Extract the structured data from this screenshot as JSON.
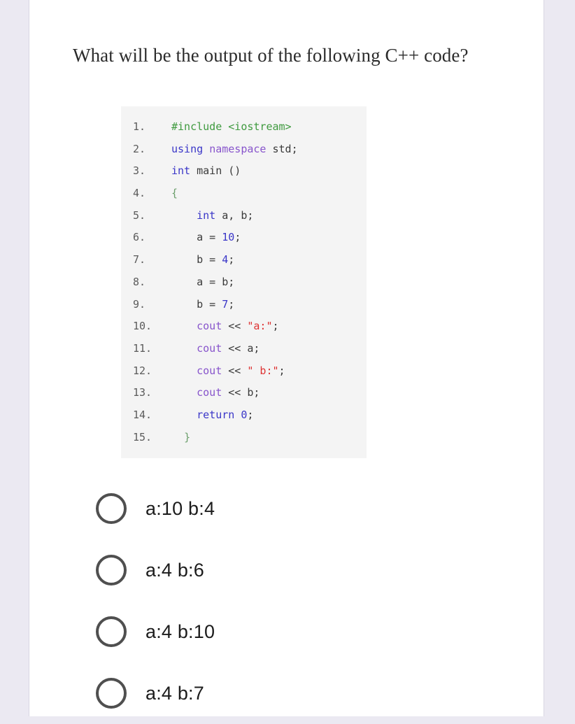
{
  "question": {
    "text": "What will be the output of the following C++ code?"
  },
  "code": {
    "language": "C++",
    "lines": [
      {
        "number": "1.",
        "tokens": [
          {
            "t": "#include ",
            "c": "pre"
          },
          {
            "t": "<iostream>",
            "c": "inc"
          }
        ]
      },
      {
        "number": "2.",
        "tokens": [
          {
            "t": "using ",
            "c": "kw"
          },
          {
            "t": "namespace ",
            "c": "ns"
          },
          {
            "t": "std;",
            "c": "plain"
          }
        ]
      },
      {
        "number": "3.",
        "tokens": [
          {
            "t": "int ",
            "c": "kw"
          },
          {
            "t": "main ()",
            "c": "plain"
          }
        ]
      },
      {
        "number": "4.",
        "tokens": [
          {
            "t": "{",
            "c": "brace"
          }
        ]
      },
      {
        "number": "5.",
        "tokens": [
          {
            "t": "    ",
            "c": "plain"
          },
          {
            "t": "int ",
            "c": "kw"
          },
          {
            "t": "a, b;",
            "c": "plain"
          }
        ]
      },
      {
        "number": "6.",
        "tokens": [
          {
            "t": "    a = ",
            "c": "plain"
          },
          {
            "t": "10",
            "c": "num"
          },
          {
            "t": ";",
            "c": "plain"
          }
        ]
      },
      {
        "number": "7.",
        "tokens": [
          {
            "t": "    b = ",
            "c": "plain"
          },
          {
            "t": "4",
            "c": "num"
          },
          {
            "t": ";",
            "c": "plain"
          }
        ]
      },
      {
        "number": "8.",
        "tokens": [
          {
            "t": "    a = b;",
            "c": "plain"
          }
        ]
      },
      {
        "number": "9.",
        "tokens": [
          {
            "t": "    b = ",
            "c": "plain"
          },
          {
            "t": "7",
            "c": "num"
          },
          {
            "t": ";",
            "c": "plain"
          }
        ]
      },
      {
        "number": "10.",
        "tokens": [
          {
            "t": "    ",
            "c": "plain"
          },
          {
            "t": "cout",
            "c": "ns"
          },
          {
            "t": " << ",
            "c": "plain"
          },
          {
            "t": "\"a:\"",
            "c": "str"
          },
          {
            "t": ";",
            "c": "plain"
          }
        ]
      },
      {
        "number": "11.",
        "tokens": [
          {
            "t": "    ",
            "c": "plain"
          },
          {
            "t": "cout",
            "c": "ns"
          },
          {
            "t": " << a;",
            "c": "plain"
          }
        ]
      },
      {
        "number": "12.",
        "tokens": [
          {
            "t": "    ",
            "c": "plain"
          },
          {
            "t": "cout",
            "c": "ns"
          },
          {
            "t": " << ",
            "c": "plain"
          },
          {
            "t": "\" b:\"",
            "c": "str"
          },
          {
            "t": ";",
            "c": "plain"
          }
        ]
      },
      {
        "number": "13.",
        "tokens": [
          {
            "t": "    ",
            "c": "plain"
          },
          {
            "t": "cout",
            "c": "ns"
          },
          {
            "t": " << b;",
            "c": "plain"
          }
        ]
      },
      {
        "number": "14.",
        "tokens": [
          {
            "t": "    ",
            "c": "plain"
          },
          {
            "t": "return ",
            "c": "kw"
          },
          {
            "t": "0",
            "c": "num"
          },
          {
            "t": ";",
            "c": "plain"
          }
        ]
      },
      {
        "number": "15.",
        "tokens": [
          {
            "t": "  ",
            "c": "plain"
          },
          {
            "t": "}",
            "c": "brace"
          }
        ]
      }
    ]
  },
  "options": [
    {
      "label": "a:10 b:4",
      "selected": false
    },
    {
      "label": "a:4 b:6",
      "selected": false
    },
    {
      "label": "a:4 b:10",
      "selected": false
    },
    {
      "label": "a:4 b:7",
      "selected": false
    }
  ],
  "colors": {
    "page_background": "#ebe9f2",
    "card_background": "#ffffff",
    "code_background": "#f4f4f4",
    "radio_border": "#4f4f4f",
    "keyword": "#3a36c8",
    "preprocessor": "#3f9a3f",
    "string": "#dd3333",
    "namespace": "#8855cc",
    "text": "#1c1c1c"
  }
}
